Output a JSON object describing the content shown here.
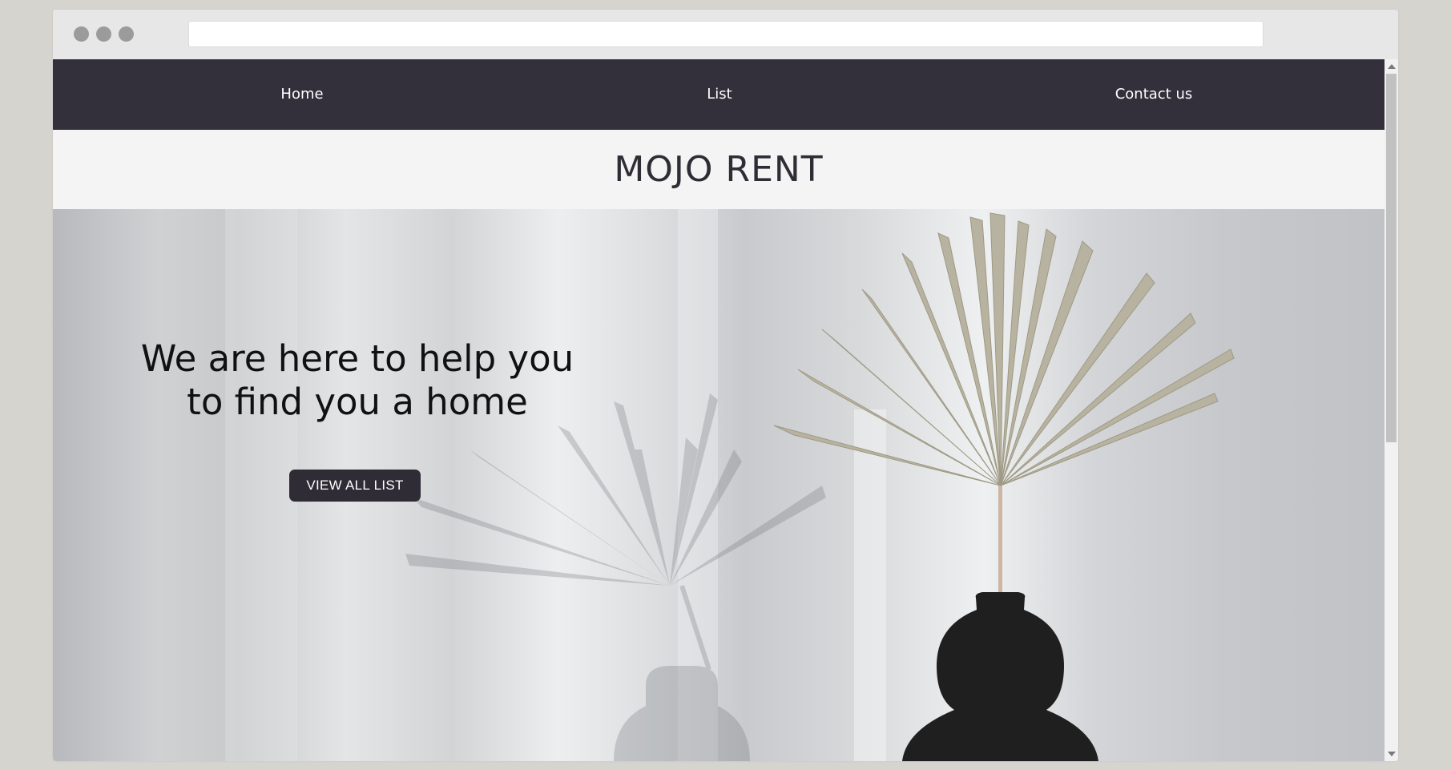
{
  "browser": {
    "url": ""
  },
  "nav": {
    "items": [
      {
        "label": "Home"
      },
      {
        "label": "List"
      },
      {
        "label": "Contact us"
      }
    ]
  },
  "brand": {
    "title": "MOJO RENT"
  },
  "hero": {
    "heading_line1": "We are here to help you",
    "heading_line2": "to find you a home",
    "button_label": "VIEW ALL LIST",
    "image": "dried-palm-leaf-in-black-vase"
  },
  "colors": {
    "nav_background": "#33303b",
    "brand_bar_background": "#f4f4f4",
    "brand_text": "#2f2c36",
    "button_background": "#2f2c36",
    "page_background": "#d6d4cf"
  }
}
